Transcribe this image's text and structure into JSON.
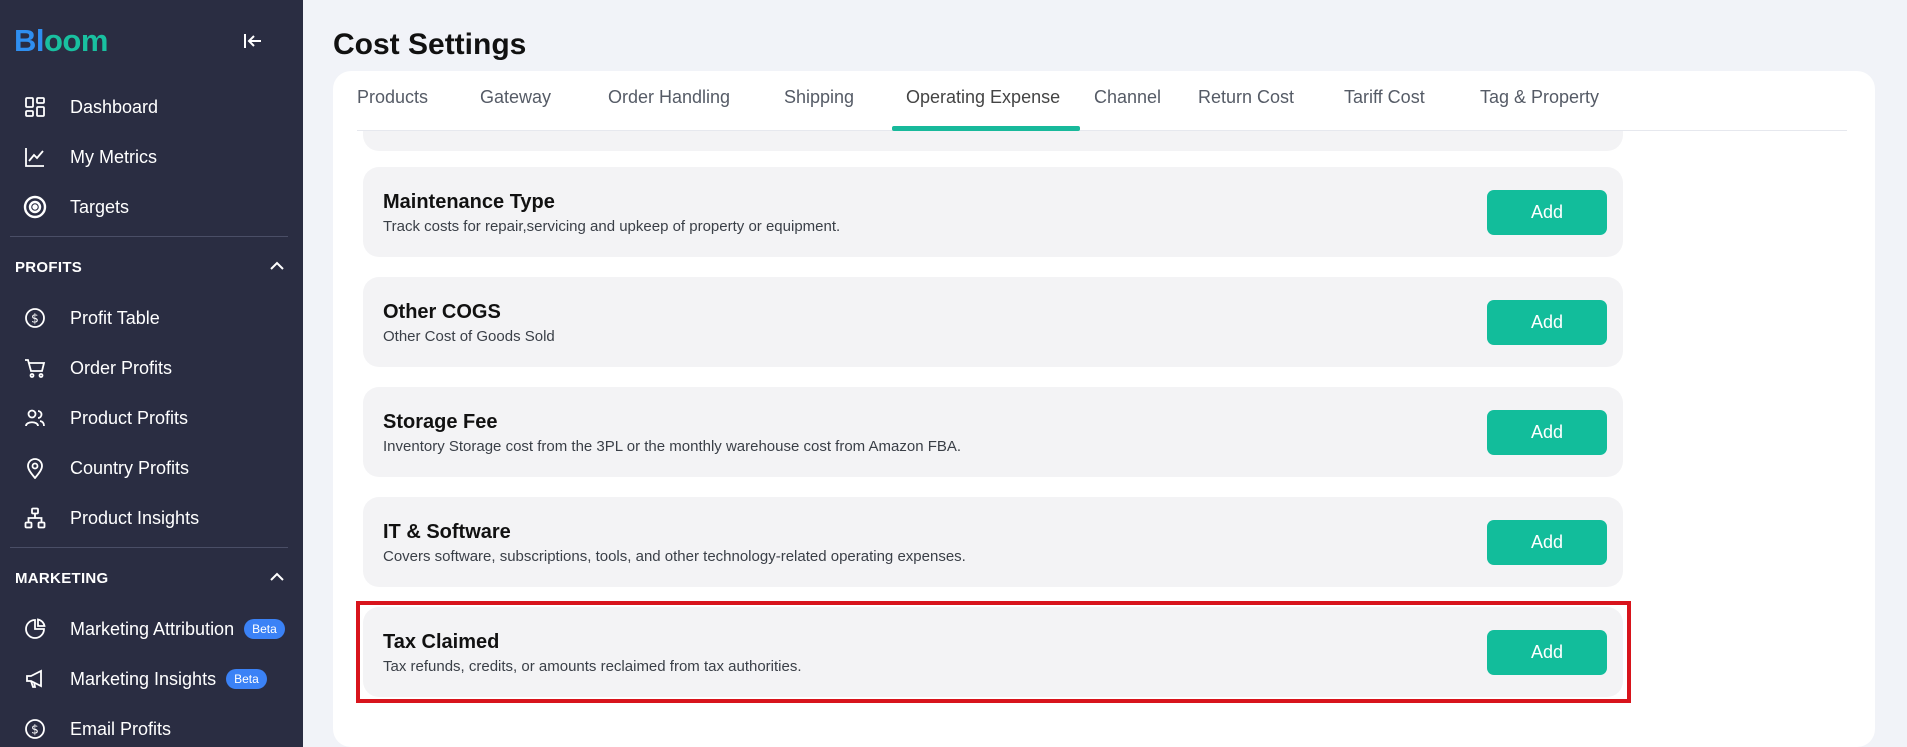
{
  "logo": {
    "part1": "Bl",
    "part2": "oo",
    "part3": "m"
  },
  "sidebar": {
    "top_items": [
      {
        "label": "Dashboard",
        "icon": "dashboard-icon"
      },
      {
        "label": "My Metrics",
        "icon": "chart-line-icon"
      },
      {
        "label": "Targets",
        "icon": "target-icon"
      }
    ],
    "profits_section": {
      "title": "PROFITS",
      "items": [
        {
          "label": "Profit Table",
          "icon": "dollar-circle-icon"
        },
        {
          "label": "Order Profits",
          "icon": "cart-icon"
        },
        {
          "label": "Product Profits",
          "icon": "users-icon"
        },
        {
          "label": "Country Profits",
          "icon": "map-pin-icon"
        },
        {
          "label": "Product Insights",
          "icon": "hierarchy-icon"
        }
      ]
    },
    "marketing_section": {
      "title": "MARKETING",
      "items": [
        {
          "label": "Marketing Attribution",
          "icon": "pie-chart-icon",
          "badge": "Beta"
        },
        {
          "label": "Marketing Insights",
          "icon": "megaphone-icon",
          "badge": "Beta"
        },
        {
          "label": "Email Profits",
          "icon": "dollar-circle-icon"
        }
      ]
    }
  },
  "page": {
    "title": "Cost Settings"
  },
  "tabs": [
    {
      "label": "Products"
    },
    {
      "label": "Gateway"
    },
    {
      "label": "Order Handling"
    },
    {
      "label": "Shipping"
    },
    {
      "label": "Operating Expense",
      "active": true
    },
    {
      "label": "Channel"
    },
    {
      "label": "Return Cost"
    },
    {
      "label": "Tariff Cost"
    },
    {
      "label": "Tag & Property"
    }
  ],
  "expenses": [
    {
      "title": "Maintenance Type",
      "description": "Track costs for repair,servicing and upkeep of property or equipment.",
      "button": "Add"
    },
    {
      "title": "Other COGS",
      "description": "Other Cost of Goods Sold",
      "button": "Add"
    },
    {
      "title": "Storage Fee",
      "description": "Inventory Storage cost from the 3PL or the monthly warehouse cost from Amazon FBA.",
      "button": "Add"
    },
    {
      "title": "IT & Software",
      "description": "Covers software, subscriptions, tools, and other technology-related operating expenses.",
      "button": "Add"
    },
    {
      "title": "Tax Claimed",
      "description": "Tax refunds, credits, or amounts reclaimed from tax authorities.",
      "button": "Add"
    }
  ],
  "colors": {
    "sidebar_bg": "#2a2d42",
    "accent": "#12bd9b",
    "highlight": "#d8141c",
    "badge": "#3b82f6"
  }
}
